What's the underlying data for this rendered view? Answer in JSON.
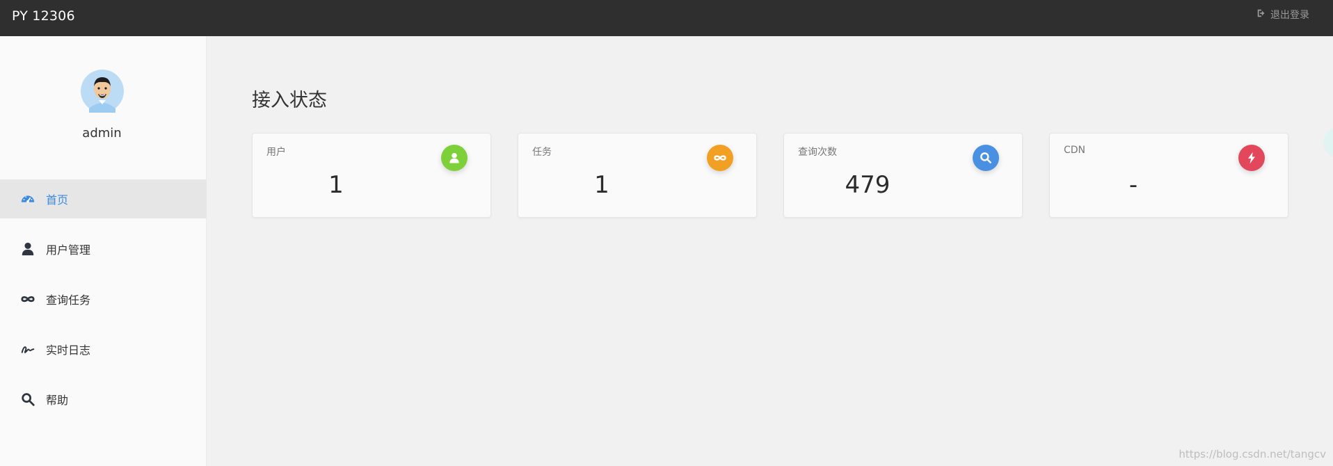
{
  "header": {
    "brand": "PY 12306",
    "logout_label": "退出登录"
  },
  "sidebar": {
    "username": "admin",
    "items": [
      {
        "label": "首页",
        "icon": "dashboard-icon",
        "active": true
      },
      {
        "label": "用户管理",
        "icon": "user-icon"
      },
      {
        "label": "查询任务",
        "icon": "infinity-icon"
      },
      {
        "label": "实时日志",
        "icon": "signature-icon"
      },
      {
        "label": "帮助",
        "icon": "search-icon"
      }
    ]
  },
  "main": {
    "title": "接入状态",
    "cards": [
      {
        "label": "用户",
        "value": "1",
        "icon": "user-icon",
        "color": "#7ed03b"
      },
      {
        "label": "任务",
        "value": "1",
        "icon": "infinity-icon",
        "color": "#f2a024"
      },
      {
        "label": "查询次数",
        "value": "479",
        "icon": "search-icon",
        "color": "#4a90e2"
      },
      {
        "label": "CDN",
        "value": "-",
        "icon": "bolt-icon",
        "color": "#e2475b"
      }
    ]
  },
  "watermark": "https://blog.csdn.net/tangcv",
  "colors": {
    "topbar": "#2f2f2f",
    "accent": "#3b8ae0"
  }
}
